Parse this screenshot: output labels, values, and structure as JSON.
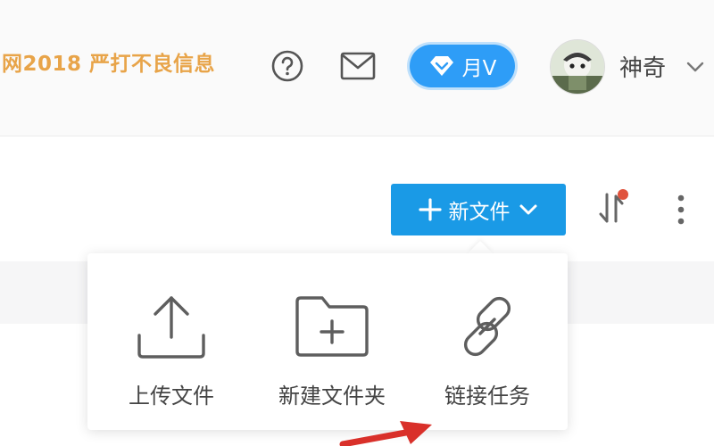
{
  "header": {
    "notice_text": "网2018 严打不良信息",
    "vip_label": "月V",
    "username": "神奇",
    "icons": {
      "help": "question-circle-icon",
      "mail": "envelope-icon",
      "vip": "diamond-icon",
      "user_menu": "chevron-down-icon"
    }
  },
  "toolbar": {
    "new_file_label": "新文件",
    "icons": {
      "new_file_plus": "plus-icon",
      "new_file_caret": "chevron-down-icon",
      "sort": "sort-icon",
      "more": "more-vertical-icon"
    }
  },
  "dropdown": {
    "items": [
      {
        "label": "上传文件",
        "icon": "upload-icon"
      },
      {
        "label": "新建文件夹",
        "icon": "folder-plus-icon"
      },
      {
        "label": "链接任务",
        "icon": "link-icon"
      }
    ]
  },
  "colors": {
    "notice": "#e8a449",
    "vip_badge": "#2e9df7",
    "primary_button": "#1a9ae6",
    "badge_dot": "#e0533d",
    "annotation_arrow": "#d9302a"
  }
}
